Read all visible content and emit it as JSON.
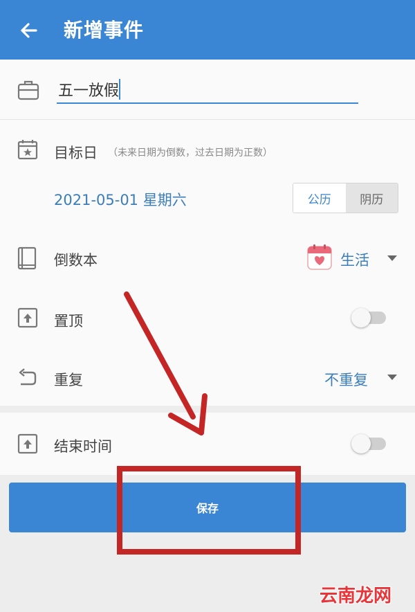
{
  "header": {
    "title": "新增事件"
  },
  "event": {
    "name_value": "五一放假"
  },
  "target_date": {
    "label": "目标日",
    "hint": "（未来日期为倒数，过去日期为正数）",
    "date": "2021-05-01 星期六",
    "calendar_options": [
      "公历",
      "阴历"
    ]
  },
  "book": {
    "label": "倒数本",
    "value": "生活"
  },
  "pin": {
    "label": "置顶",
    "enabled": false
  },
  "repeat": {
    "label": "重复",
    "value": "不重复"
  },
  "end_time": {
    "label": "结束时间",
    "enabled": false
  },
  "save": {
    "label": "保存"
  },
  "watermark": "云南龙网",
  "colors": {
    "primary": "#3a86d4",
    "accent_text": "#3a7db8",
    "annotation": "#c42626"
  }
}
